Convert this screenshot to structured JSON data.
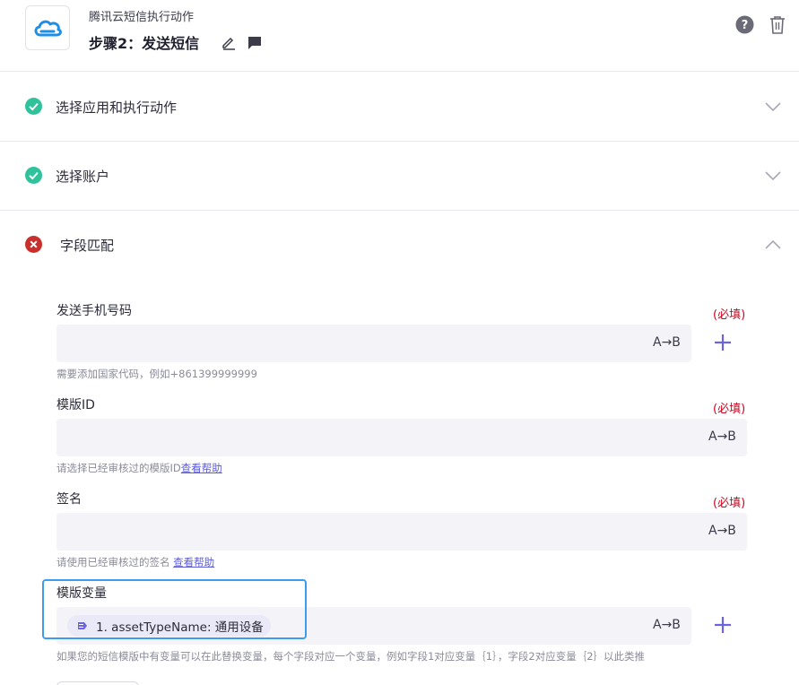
{
  "header": {
    "app_name": "腾讯云短信执行动作",
    "step_title": "步骤2：发送短信",
    "logo_icon": "tencent-cloud-logo",
    "help_icon": "help-icon",
    "delete_icon": "trash-icon"
  },
  "sections": [
    {
      "title": "选择应用和执行动作",
      "status": "complete",
      "expanded": false
    },
    {
      "title": "选择账户",
      "status": "complete",
      "expanded": false
    },
    {
      "title": "字段匹配",
      "status": "error",
      "expanded": true
    }
  ],
  "fields": [
    {
      "label": "发送手机号码",
      "required": "(必填)",
      "map_label": "A→B",
      "value": "",
      "hint": "需要添加国家代码，例如+861399999999",
      "hint_link": ""
    },
    {
      "label": "模版ID",
      "required": "(必填)",
      "map_label": "A→B",
      "value": "",
      "hint": "请选择已经审核过的模版ID",
      "hint_link": "查看帮助"
    },
    {
      "label": "签名",
      "required": "(必填)",
      "map_label": "A→B",
      "value": "",
      "hint": "请使用已经审核过的签名",
      "hint_link": "查看帮助"
    },
    {
      "label": "模版变量",
      "required": "",
      "map_label": "A→B",
      "chip": "1. assetTypeName: 通用设备",
      "hint": "如果您的短信模版中有变量可以在此替换变量，每个字段对应一个变量，例如字段1对应变量｛1｝，字段2对应变量｛2｝以此类推",
      "hint_link": ""
    }
  ],
  "colors": {
    "success": "#2fc29b",
    "error": "#c9302c",
    "accent": "#6c63e0",
    "required": "#d0021b",
    "highlight": "#3b9cf0"
  }
}
